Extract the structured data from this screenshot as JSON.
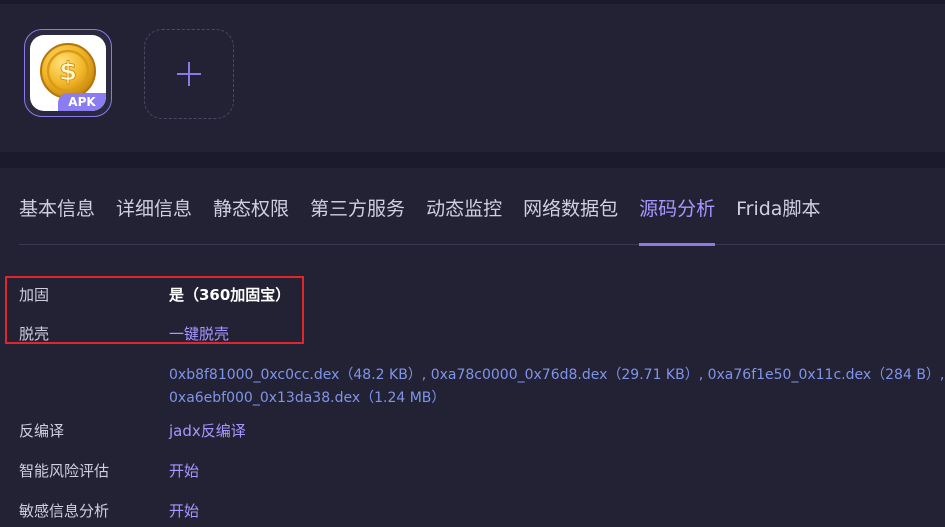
{
  "app": {
    "badge": "APK",
    "icon": "gold-coin-dollar-icon",
    "add_icon": "plus-icon"
  },
  "tabs": [
    {
      "label": "基本信息",
      "active": false
    },
    {
      "label": "详细信息",
      "active": false
    },
    {
      "label": "静态权限",
      "active": false
    },
    {
      "label": "第三方服务",
      "active": false
    },
    {
      "label": "动态监控",
      "active": false
    },
    {
      "label": "网络数据包",
      "active": false
    },
    {
      "label": "源码分析",
      "active": true
    },
    {
      "label": "Frida脚本",
      "active": false
    }
  ],
  "details": {
    "hardening_label": "加固",
    "hardening_value": "是（360加固宝）",
    "unpack_label": "脱壳",
    "unpack_action": "一键脱壳",
    "dex_line1": "0xb8f81000_0xc0cc.dex（48.2 KB）, 0xa78c0000_0x76d8.dex（29.71 KB）, 0xa76f1e50_0x11c.dex（284 B）,",
    "dex_line2": "0xa6ebf000_0x13da38.dex（1.24 MB）",
    "decompile_label": "反编译",
    "decompile_action": "jadx反编译",
    "risk_label": "智能风险评估",
    "risk_action": "开始",
    "sensitive_label": "敏感信息分析",
    "sensitive_action": "开始"
  },
  "colors": {
    "background": "#1b1a2b",
    "panel": "#232235",
    "accent": "#8a7ae6",
    "link": "#a897ff",
    "dex_link": "#7f94e8",
    "highlight": "#e0262b"
  }
}
